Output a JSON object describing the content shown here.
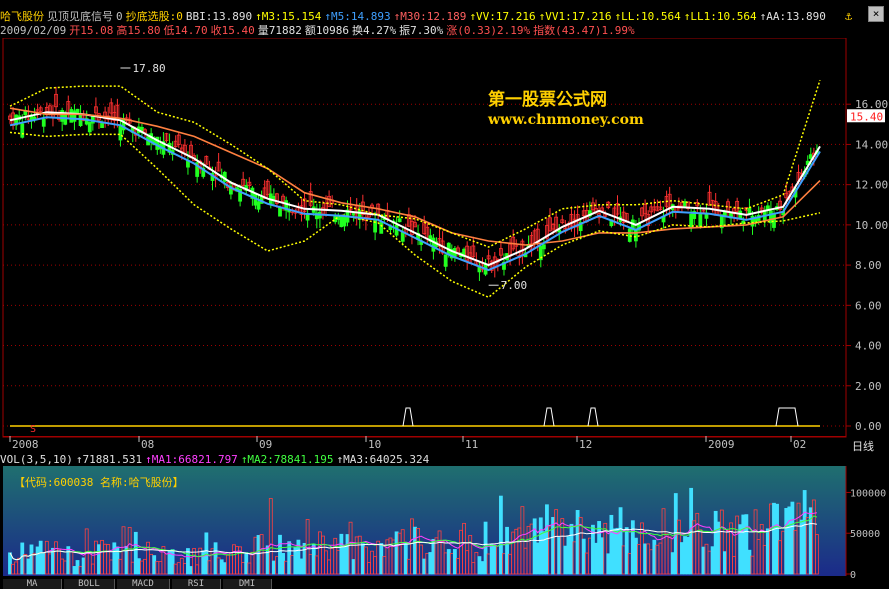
{
  "header1": {
    "stock_name": "哈飞股份",
    "indicator_name": "见顶见底信号",
    "indicator_val": "0",
    "screen_name": "抄底选股:0",
    "items": [
      {
        "label": "BBI:13.890",
        "color": "#e0e0e0"
      },
      {
        "label": "M3:15.154",
        "color": "#ffff00"
      },
      {
        "label": "M5:14.893",
        "color": "#3fa0ff"
      },
      {
        "label": "M30:12.189",
        "color": "#ff6060"
      },
      {
        "label": "VV:17.216",
        "color": "#ffff00"
      },
      {
        "label": "VV1:17.216",
        "color": "#ffff00"
      },
      {
        "label": "LL:10.564",
        "color": "#ffff00"
      },
      {
        "label": "LL1:10.564",
        "color": "#ffff00"
      },
      {
        "label": "AA:13.890",
        "color": "#e0e0e0"
      }
    ]
  },
  "header2": {
    "date": "2009/02/09",
    "items": [
      {
        "label": "开15.08",
        "color": "#ff5050"
      },
      {
        "label": "高15.80",
        "color": "#ff5050"
      },
      {
        "label": "低14.70",
        "color": "#ff5050"
      },
      {
        "label": "收15.40",
        "color": "#ff5050"
      },
      {
        "label": "量71882",
        "color": "#e0e0e0"
      },
      {
        "label": "额10986",
        "color": "#e0e0e0"
      },
      {
        "label": "换4.27%",
        "color": "#e0e0e0"
      },
      {
        "label": "振7.30%",
        "color": "#e0e0e0"
      },
      {
        "label": "涨(0.33)2.19%",
        "color": "#ff5050"
      },
      {
        "label": "指数(43.47)1.99%",
        "color": "#ff5050"
      }
    ]
  },
  "watermark": {
    "title": "第一股票公式网",
    "url": "www.chnmoney.com"
  },
  "price_axis": {
    "labels": [
      "16.00",
      "14.00",
      "12.00",
      "10.00",
      "8.00",
      "6.00",
      "4.00",
      "2.00",
      "0.00"
    ],
    "current_price": "15.40"
  },
  "annotations": {
    "high": "17.80",
    "low": "7.00",
    "signal_marker": "S"
  },
  "period_label": "日线",
  "time_axis": {
    "labels": [
      "2008",
      "08",
      "09",
      "10",
      "11",
      "12",
      "2009",
      "02"
    ]
  },
  "volume_header": {
    "items": [
      {
        "label": "VOL(3,5,10)",
        "color": "#e0e0e0"
      },
      {
        "label": "71881.531",
        "color": "#e0e0e0"
      },
      {
        "label": "MA1:66821.797",
        "color": "#ff40ff"
      },
      {
        "label": "MA2:78841.195",
        "color": "#40ff40"
      },
      {
        "label": "MA3:64025.324",
        "color": "#e0e0e0"
      }
    ]
  },
  "volume_info": {
    "text": "【代码:600038 名称:哈飞股份】"
  },
  "volume_axis": {
    "labels": [
      "100000",
      "50000",
      "0"
    ]
  },
  "tabs": [
    "MA",
    "BOLL",
    "MACD",
    "RSI",
    "DMI"
  ],
  "colors": {
    "up": "#ff3030",
    "down": "#20ff20",
    "blue": "#3fa0ff",
    "yellow": "#ffff00",
    "orange": "#ff8040",
    "white": "#ffffff"
  },
  "chart_data": {
    "type": "line",
    "title": "",
    "x_labels": [
      "2008",
      "08",
      "09",
      "10",
      "11",
      "12",
      "2009",
      "02"
    ],
    "ylim": [
      0,
      17.8
    ],
    "series": [
      {
        "name": "BBI",
        "values": [
          15.2,
          15.6,
          15.5,
          15.2,
          14.2,
          13.3,
          12.1,
          11.3,
          10.8,
          10.7,
          10.5,
          9.6,
          8.7,
          8.0,
          8.8,
          9.9,
          10.7,
          10.0,
          10.9,
          10.8,
          10.5,
          10.9,
          13.9
        ]
      },
      {
        "name": "M30",
        "values": [
          15.8,
          15.5,
          15.5,
          15.3,
          14.9,
          14.4,
          13.6,
          12.8,
          11.6,
          11.1,
          10.8,
          10.4,
          9.6,
          9.2,
          9.0,
          9.2,
          9.6,
          9.6,
          9.8,
          9.9,
          10.0,
          10.4,
          12.2
        ]
      },
      {
        "name": "VV",
        "values": [
          15.9,
          16.8,
          16.9,
          16.9,
          15.6,
          15.1,
          14.0,
          12.8,
          11.2,
          11.0,
          10.5,
          10.3,
          9.6,
          8.9,
          9.8,
          10.8,
          11.0,
          11.0,
          11.2,
          11.0,
          10.8,
          11.5,
          17.2
        ]
      },
      {
        "name": "LL",
        "values": [
          14.6,
          14.4,
          14.5,
          14.5,
          12.8,
          11.0,
          9.8,
          8.7,
          9.2,
          10.5,
          10.1,
          8.5,
          7.2,
          6.4,
          7.9,
          9.0,
          9.7,
          9.4,
          10.0,
          9.9,
          10.1,
          10.2,
          10.6
        ]
      }
    ],
    "annotations": [
      {
        "label": "17.80",
        "x": 3,
        "y": 17.8
      },
      {
        "label": "7.00",
        "x": 13,
        "y": 7.0
      }
    ],
    "volume": {
      "ylim": [
        0,
        130000
      ],
      "values": [
        22000,
        30000,
        18000,
        40000,
        25000,
        20000,
        28000,
        32000,
        45000,
        35000,
        26000,
        44000,
        38000,
        30000,
        55000,
        60000,
        50000,
        42000,
        65000,
        50000,
        48000,
        60000,
        71882
      ]
    }
  }
}
